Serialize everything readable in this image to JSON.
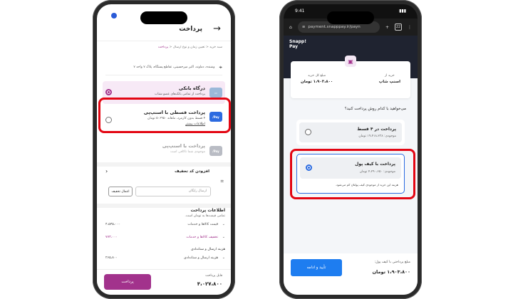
{
  "left": {
    "header_title": "پرداخت",
    "breadcrumb": [
      "سبد خرید",
      "تعیین زمان و نوع ارسال",
      "پرداخت"
    ],
    "address": "وشنده، دماوند، اکبر میرحسینی، تقاطع پستگاه، پلاک ۷ واحد ۷",
    "bank": {
      "title": "درگاه بانکی",
      "subtitle": "پرداخت از تمامی بانک‌های عضو شتاب"
    },
    "installment": {
      "title": "پرداخت قسطی با اسنپ‌پی",
      "subtitle": "۴ قسط بدون کارمزد، ماهانه ۵۰۶۹۵۰ تومان",
      "more": "اطلاعات بیشتر",
      "logo": "Pay/"
    },
    "snapp": {
      "title": "پرداخت با اسنپ‌پی",
      "subtitle": "موجودی شما ناکافی است",
      "logo": "Pay/"
    },
    "discount": {
      "title": "افزودن کد تخفیف",
      "placeholder": "ارسال رایگان",
      "button": "اعمال تخفیف"
    },
    "payinfo": {
      "title": "اطلاعات پرداخت",
      "subtitle": "تمامی قیمت‌ها به تومان است.",
      "rows": [
        {
          "k": "قیمت کالاها و خدمات",
          "v": "۴،۵۳۵،۰۰۰"
        },
        {
          "k": "تخفیف کالاها و خدمات",
          "v": "۷۷۳،۰۰۰"
        }
      ],
      "section": "هزینه ارسال و ستاندادی",
      "row3": {
        "k": "هزینه ارسال و ستاندادی",
        "v": "۲۶۵،۸۰۰"
      }
    },
    "footer": {
      "label": "قابل پرداخت",
      "amount": "۴،۰۲۷،۸۰۰",
      "button": "پرداخت"
    }
  },
  "right": {
    "status_time": "9:41",
    "url": "payment.snapppay.ir/payn",
    "tabs": "22",
    "brand": "Snapp!\nPay",
    "purchase_from_label": "خرید از",
    "purchase_from_value": "اسنپ شاپ",
    "total_label": "مبلغ کل خرید",
    "total_value": "۱،۹۰۳،۸۰۰ تومان",
    "question": "می‌خواهید با کدام روش پرداخت کنید؟",
    "installment": {
      "title": "پرداخت در ۴ قسط",
      "subtitle": "موجودی: ۱۹،۴۱۸،۲۳۸ تومان"
    },
    "wallet": {
      "title": "پرداخت با کیف پول",
      "subtitle": "موجودی: ۴،۲۹۰،۶۵۰ تومان",
      "note": "هزینه این خرید از موجودی کیف پولتان کم می‌شود."
    },
    "footer": {
      "label": "مبلغ پرداختی با کیف پول:",
      "amount": "۱،۹۰۳،۸۰۰ تومان",
      "button": "تأیید و ادامه"
    }
  }
}
